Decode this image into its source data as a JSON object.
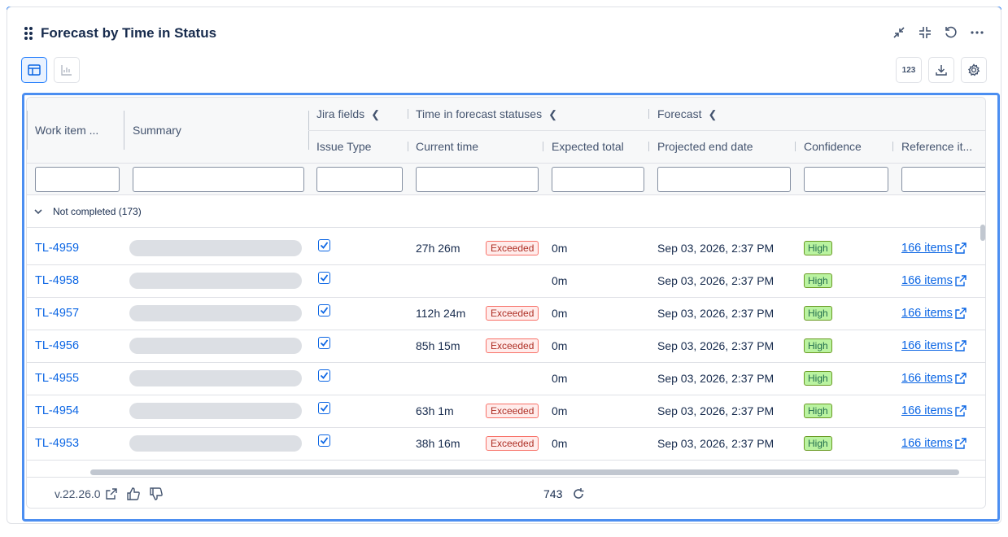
{
  "widget": {
    "title": "Forecast by Time in Status",
    "actions": [
      "collapse-icon",
      "minimize-icon",
      "reset-icon",
      "more-icon"
    ],
    "view_modes": [
      "table-view-icon",
      "chart-view-icon"
    ],
    "tools": {
      "number_format_label": "123",
      "download": "download-icon",
      "settings": "gear-icon"
    }
  },
  "table": {
    "group_headers": {
      "jira_fields": "Jira fields",
      "time_in_forecast": "Time in forecast statuses",
      "forecast": "Forecast"
    },
    "columns": {
      "work_item": "Work item ...",
      "summary": "Summary",
      "issue_type": "Issue Type",
      "current_time": "Current time",
      "expected_total": "Expected total",
      "projected_end_date": "Projected end date",
      "confidence": "Confidence",
      "reference_items": "Reference it..."
    },
    "group": {
      "label": "Not completed (173)"
    },
    "rows": [
      {
        "key": "TL-4959",
        "current_time": "27h 26m",
        "status": "Exceeded",
        "expected": "0m",
        "end_date": "Sep 03, 2026, 2:37 PM",
        "confidence": "High",
        "ref": "166 items"
      },
      {
        "key": "TL-4958",
        "current_time": "",
        "status": "",
        "expected": "0m",
        "end_date": "Sep 03, 2026, 2:37 PM",
        "confidence": "High",
        "ref": "166 items"
      },
      {
        "key": "TL-4957",
        "current_time": "112h 24m",
        "status": "Exceeded",
        "expected": "0m",
        "end_date": "Sep 03, 2026, 2:37 PM",
        "confidence": "High",
        "ref": "166 items"
      },
      {
        "key": "TL-4956",
        "current_time": "85h 15m",
        "status": "Exceeded",
        "expected": "0m",
        "end_date": "Sep 03, 2026, 2:37 PM",
        "confidence": "High",
        "ref": "166 items"
      },
      {
        "key": "TL-4955",
        "current_time": "",
        "status": "",
        "expected": "0m",
        "end_date": "Sep 03, 2026, 2:37 PM",
        "confidence": "High",
        "ref": "166 items"
      },
      {
        "key": "TL-4954",
        "current_time": "63h 1m",
        "status": "Exceeded",
        "expected": "0m",
        "end_date": "Sep 03, 2026, 2:37 PM",
        "confidence": "High",
        "ref": "166 items"
      },
      {
        "key": "TL-4953",
        "current_time": "38h 16m",
        "status": "Exceeded",
        "expected": "0m",
        "end_date": "Sep 03, 2026, 2:37 PM",
        "confidence": "High",
        "ref": "166 items"
      }
    ]
  },
  "footer": {
    "version": "v.22.26.0",
    "count": "743"
  },
  "colors": {
    "accent": "#1d7afc",
    "link": "#0c66e4",
    "exceeded": "#f87168",
    "high": "#baf3a0"
  }
}
